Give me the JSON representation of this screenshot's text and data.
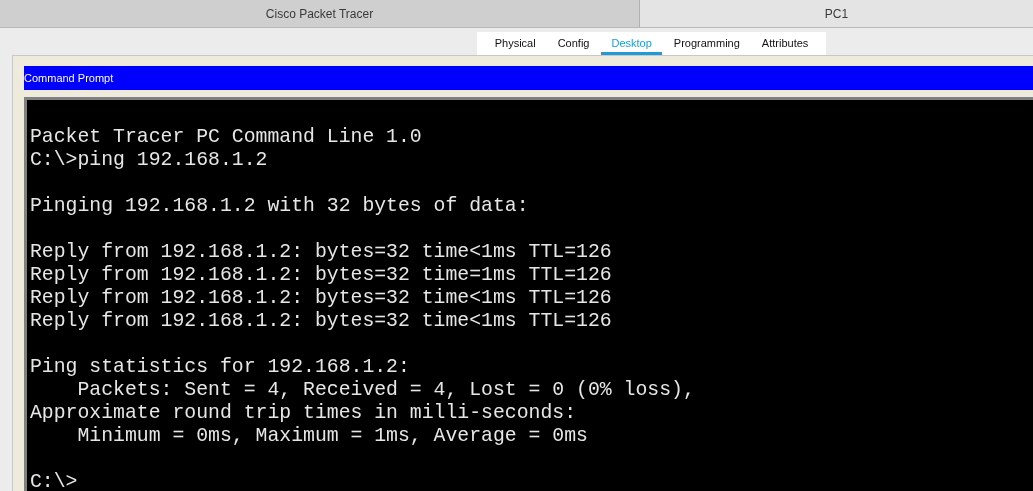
{
  "window_tabs": [
    {
      "label": "Cisco Packet Tracer",
      "selected": false
    },
    {
      "label": "PC1",
      "selected": true
    }
  ],
  "tabs": [
    {
      "label": "Physical",
      "selected": false
    },
    {
      "label": "Config",
      "selected": false
    },
    {
      "label": "Desktop",
      "selected": true
    },
    {
      "label": "Programming",
      "selected": false
    },
    {
      "label": "Attributes",
      "selected": false
    }
  ],
  "command_prompt": {
    "title": "Command Prompt",
    "blocks": [
      [
        "Packet Tracer PC Command Line 1.0",
        "C:\\>ping 192.168.1.2"
      ],
      [
        "Pinging 192.168.1.2 with 32 bytes of data:"
      ],
      [
        "Reply from 192.168.1.2: bytes=32 time<1ms TTL=126",
        "Reply from 192.168.1.2: bytes=32 time=1ms TTL=126",
        "Reply from 192.168.1.2: bytes=32 time<1ms TTL=126",
        "Reply from 192.168.1.2: bytes=32 time<1ms TTL=126"
      ],
      [
        "Ping statistics for 192.168.1.2:",
        "    Packets: Sent = 4, Received = 4, Lost = 0 (0% loss),",
        "Approximate round trip times in milli-seconds:",
        "    Minimum = 0ms, Maximum = 1ms, Average = 0ms"
      ],
      [
        "C:\\>"
      ]
    ]
  }
}
